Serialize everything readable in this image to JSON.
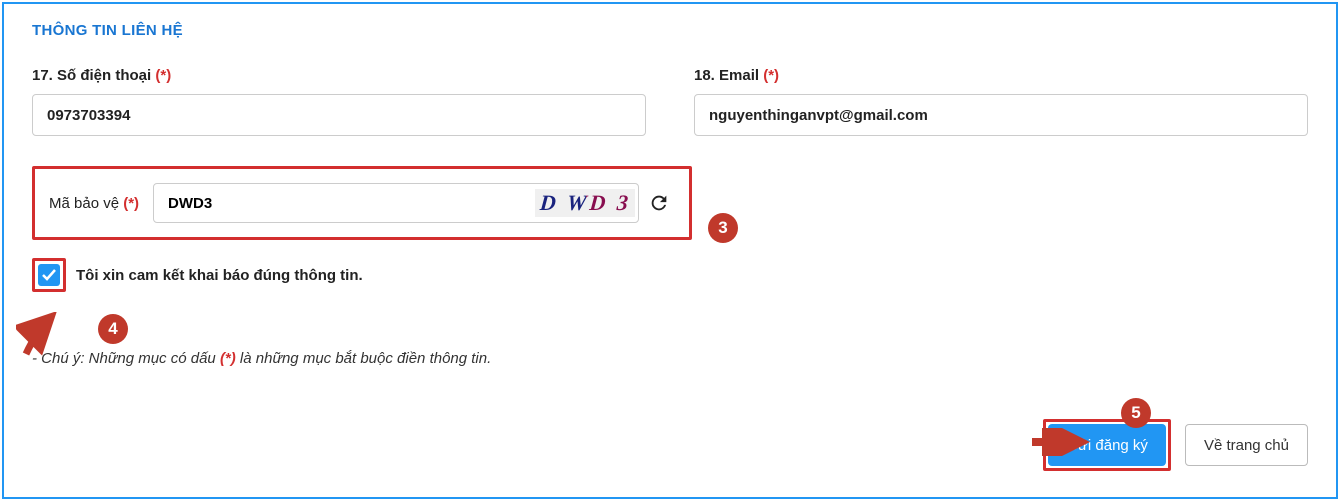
{
  "section_title": "THÔNG TIN LIÊN HỆ",
  "fields": {
    "phone": {
      "label": "17. Số điện thoại",
      "value": "0973703394"
    },
    "email": {
      "label": "18. Email",
      "value": "nguyenthinganvpt@gmail.com"
    }
  },
  "captcha": {
    "label": "Mã bảo vệ",
    "value": "DWD3",
    "image_text": "D WD 3"
  },
  "commit": {
    "checked": true,
    "label": "Tôi xin cam kết khai báo đúng thông tin."
  },
  "note": {
    "prefix": "- Chú ý: Những mục có dấu ",
    "marker": "(*)",
    "suffix": " là những mục bắt buộc điền thông tin."
  },
  "buttons": {
    "submit": "Gửi đăng ký",
    "home": "Về trang chủ"
  },
  "required_marker": "(*)",
  "callouts": {
    "c3": "3",
    "c4": "4",
    "c5": "5"
  }
}
